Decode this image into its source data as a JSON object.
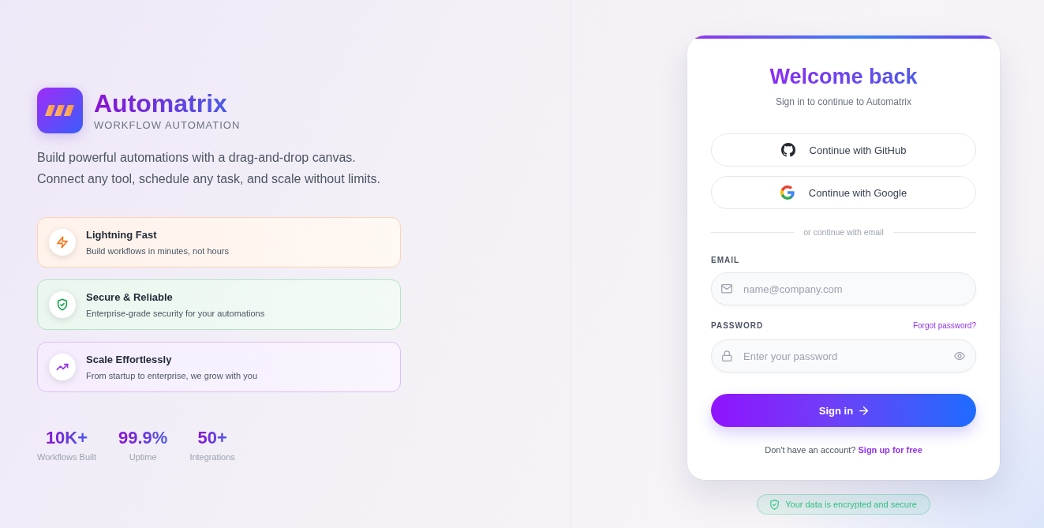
{
  "brand": {
    "name": "Automatrix",
    "tagline": "WORKFLOW AUTOMATION"
  },
  "description": "Build powerful automations with a drag-and-drop canvas. Connect any tool, schedule any task, and scale without limits.",
  "features": [
    {
      "kind": "bolt",
      "color": "#f97316",
      "title": "Lightning Fast",
      "description": "Build workflows in minutes, not hours"
    },
    {
      "kind": "shield",
      "color": "#16a34a",
      "title": "Secure & Reliable",
      "description": "Enterprise-grade security for your automations"
    },
    {
      "kind": "trend",
      "color": "#9333ea",
      "title": "Scale Effortlessly",
      "description": "From startup to enterprise, we grow with you"
    }
  ],
  "stats": [
    {
      "value": "10K+",
      "label": "Workflows Built"
    },
    {
      "value": "99.9%",
      "label": "Uptime"
    },
    {
      "value": "50+",
      "label": "Integrations"
    }
  ],
  "login": {
    "title": "Welcome back",
    "subtitle": "Sign in to continue to Automatrix",
    "social_buttons": [
      {
        "kind": "github",
        "label": "Continue with GitHub"
      },
      {
        "kind": "google",
        "label": "Continue with Google"
      }
    ],
    "divider": "or continue with email",
    "email": {
      "label": "EMAIL",
      "placeholder": "name@company.com"
    },
    "password": {
      "label": "PASSWORD",
      "placeholder": "Enter your password",
      "forgot_link": "Forgot password?"
    },
    "submit": "Sign in",
    "signup": {
      "prompt": "Don't have an account?",
      "link": "Sign up for free"
    }
  },
  "security_badge": {
    "text": "Your data is encrypted and secure"
  }
}
